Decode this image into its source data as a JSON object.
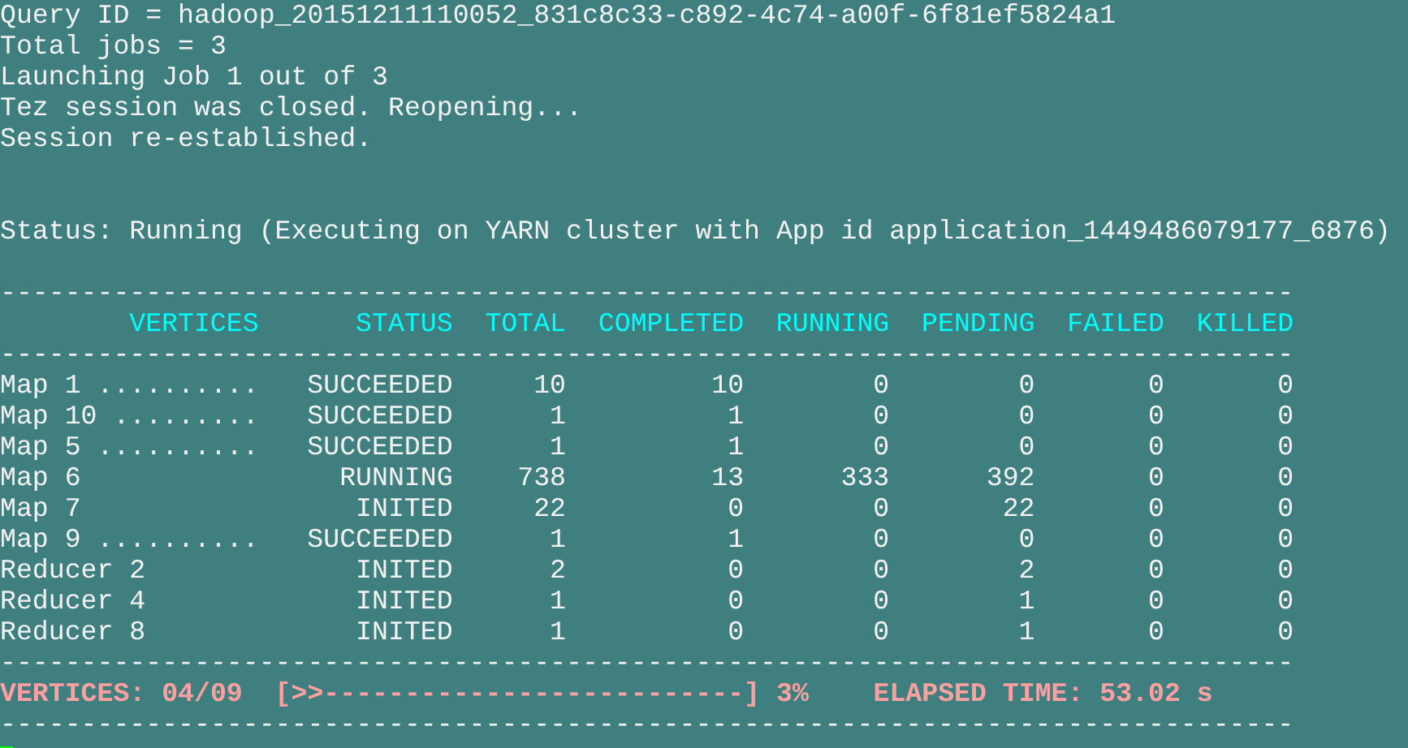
{
  "terminal": {
    "log_lines": [
      "Query ID = hadoop_20151211110052_831c8c33-c892-4c74-a00f-6f81ef5824a1",
      "Total jobs = 3",
      "Launching Job 1 out of 3",
      "Tez session was closed. Reopening...",
      "Session re-established."
    ],
    "status_line": "Status: Running (Executing on YARN cluster with App id application_1449486079177_6876)",
    "table": {
      "rule_top": "--------------------------------------------------------------------------------",
      "columns": [
        "VERTICES",
        "STATUS",
        "TOTAL",
        "COMPLETED",
        "RUNNING",
        "PENDING",
        "FAILED",
        "KILLED"
      ],
      "rule_mid": "--------------------------------------------------------------------------------",
      "rows": [
        {
          "cells": [
            "Map 1 ..........",
            "SUCCEEDED",
            "10",
            "10",
            "0",
            "0",
            "0",
            "0"
          ]
        },
        {
          "cells": [
            "Map 10 .........",
            "SUCCEEDED",
            "1",
            "1",
            "0",
            "0",
            "0",
            "0"
          ]
        },
        {
          "cells": [
            "Map 5 ..........",
            "SUCCEEDED",
            "1",
            "1",
            "0",
            "0",
            "0",
            "0"
          ]
        },
        {
          "cells": [
            "Map 6",
            "RUNNING",
            "738",
            "13",
            "333",
            "392",
            "0",
            "0"
          ]
        },
        {
          "cells": [
            "Map 7",
            "INITED",
            "22",
            "0",
            "0",
            "22",
            "0",
            "0"
          ]
        },
        {
          "cells": [
            "Map 9 ..........",
            "SUCCEEDED",
            "1",
            "1",
            "0",
            "0",
            "0",
            "0"
          ]
        },
        {
          "cells": [
            "Reducer 2",
            "INITED",
            "2",
            "0",
            "0",
            "2",
            "0",
            "0"
          ]
        },
        {
          "cells": [
            "Reducer 4",
            "INITED",
            "1",
            "0",
            "0",
            "1",
            "0",
            "0"
          ]
        },
        {
          "cells": [
            "Reducer 8",
            "INITED",
            "1",
            "0",
            "0",
            "1",
            "0",
            "0"
          ]
        }
      ],
      "rule_bottom": "--------------------------------------------------------------------------------"
    },
    "progress": {
      "label": "VERTICES: 04/09",
      "bar": "[>>--------------------------]",
      "percent": "3%",
      "elapsed": "ELAPSED TIME: 53.02 s"
    },
    "rule_end": "--------------------------------------------------------------------------------"
  }
}
